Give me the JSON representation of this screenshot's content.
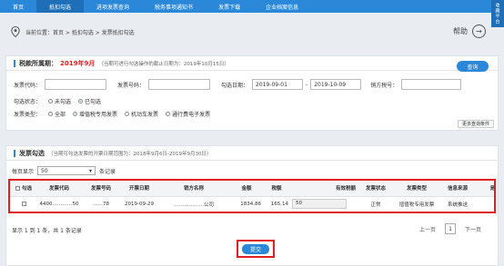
{
  "nav": {
    "items": [
      "首页",
      "抵扣勾选",
      "进项发票查询",
      "税务事项通知书",
      "发票下载",
      "企业档案信息"
    ],
    "favorite": "收藏平台"
  },
  "breadcrumb": "当前位置：首页 > 抵扣勾选 > 发票抵扣勾选",
  "help": "帮助",
  "tax_period": {
    "label": "税款所属期：",
    "value": "2019年9月",
    "note": "（当期可进行勾选操作的截止日期为：2019年10月15日）",
    "query_button": "查询"
  },
  "filters": {
    "invoice_code_label": "发票代码：",
    "invoice_code_value": "",
    "invoice_number_label": "发票号码：",
    "invoice_number_value": "",
    "date_label": "勾选日期：",
    "date_from": "2019-09-01",
    "date_sep": "-",
    "date_to": "2019-10-09",
    "seller_tax_label": "销方税号：",
    "seller_tax_value": "",
    "status_label": "勾选状态：",
    "status_options": [
      "未勾选",
      "已勾选"
    ],
    "type_label": "发票类型：",
    "type_options": [
      "全部",
      "增值税专用发票",
      "机动车发票",
      "通行费电子发票"
    ],
    "more_button": "更多查询条件"
  },
  "invoice_panel": {
    "title": "发票勾选",
    "note": "（当期可勾选发票的开票日期范围为：2018年9月6日-2019年9月30日）",
    "page_size_prefix": "每页显示",
    "page_size_value": "50",
    "page_size_suffix": "条记录"
  },
  "table": {
    "headers": [
      "勾选",
      "发票代码",
      "发票号码",
      "开票日期",
      "销方名称",
      "金额",
      "税额",
      "有效税额",
      "发票状态",
      "发票类型",
      "信息来源",
      "是否有"
    ],
    "rows": [
      {
        "code": "4400…………50",
        "number": "……78",
        "date": "2019-09-29",
        "seller": "………………公司",
        "amount": "1834.86",
        "tax": "165.14",
        "valid_tax": "50",
        "status": "正常",
        "type": "增值税专用发票",
        "source": "系统推送",
        "extra": "-"
      }
    ]
  },
  "pagination": {
    "summary": "显示 1 到 1 条，共 1 条记录",
    "prev": "上一页",
    "current": "1",
    "next": "下一页"
  },
  "submit_button": "提交",
  "colors": {
    "primary": "#2b88d9",
    "highlight": "#e02020",
    "period_red": "#e02020"
  }
}
